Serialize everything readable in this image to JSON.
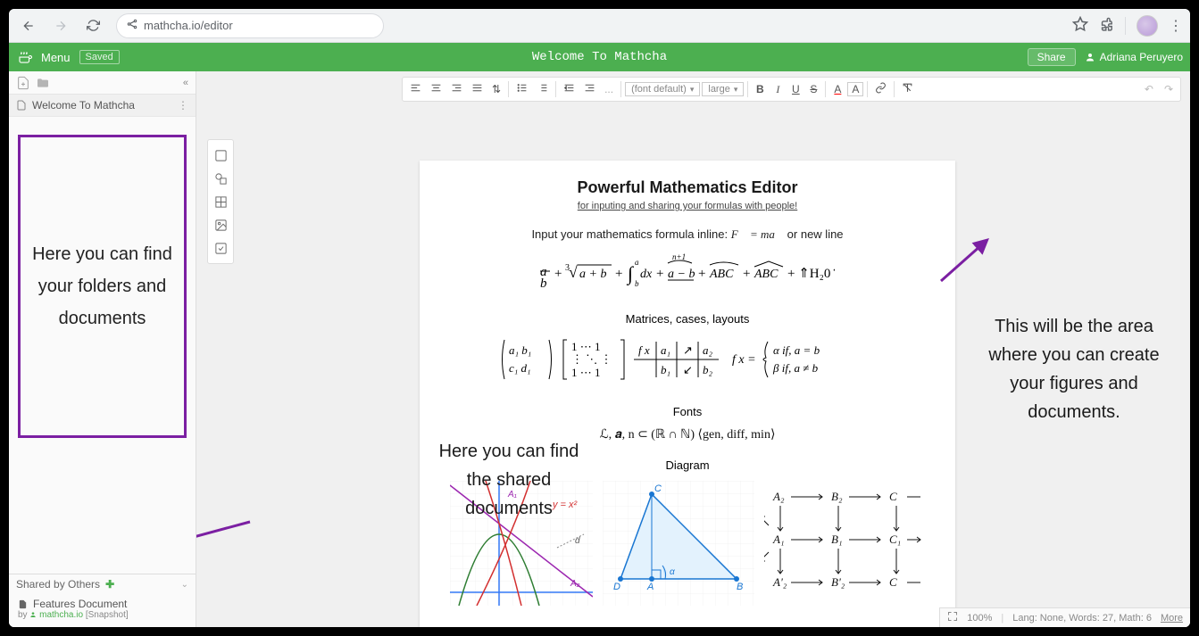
{
  "browser": {
    "url": "mathcha.io/editor"
  },
  "app": {
    "menu": "Menu",
    "saved": "Saved",
    "title": "Welcome To Mathcha",
    "share": "Share",
    "user": "Adriana Peruyero"
  },
  "sidebar": {
    "doc": "Welcome To Mathcha",
    "shared_header": "Shared by Others",
    "shared_doc": "Features Document",
    "shared_by_prefix": "by ",
    "shared_author": "mathcha.io",
    "shared_meta": " [Snapshot]"
  },
  "toolbar": {
    "font": "(font default)",
    "size": "large"
  },
  "document": {
    "title": "Powerful Mathematics Editor",
    "subtitle": "for inputing and sharing your formulas with people!",
    "inline_intro": "Input your mathematics formula inline: ",
    "inline_tail": " or new line",
    "sec_matrices": "Matrices, cases, layouts",
    "sec_fonts": "Fonts",
    "fonts_line": "ℒ, 𝒂, n ⊂ (ℝ ∩ ℕ) ⟨gen, diff, min⟩",
    "sec_diagram": "Diagram"
  },
  "annotations": {
    "folders": "Here you can find your folders and documents",
    "shared": "Here you can find the shared documents",
    "editor": "This will be the area where you can create your figures and documents."
  },
  "status": {
    "zoom": "100%",
    "info": "Lang: None, Words: 27, Math: 6",
    "more": "More"
  }
}
